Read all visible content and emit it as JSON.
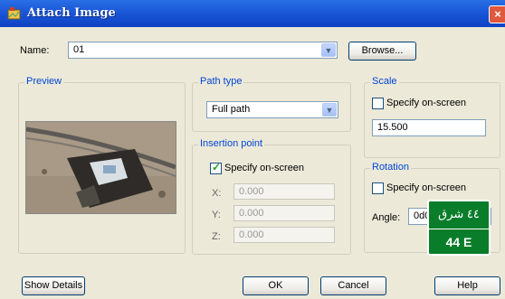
{
  "window": {
    "title": "Attach Image",
    "close_glyph": "×"
  },
  "name": {
    "label": "Name:",
    "value": "01",
    "browse_label": "Browse..."
  },
  "preview": {
    "title": "Preview"
  },
  "path_type": {
    "title": "Path type",
    "value": "Full path"
  },
  "insertion": {
    "title": "Insertion point",
    "specify_label": "Specify on-screen",
    "specify_checked": true,
    "x_label": "X:",
    "x_value": "0.000",
    "y_label": "Y:",
    "y_value": "0.000",
    "z_label": "Z:",
    "z_value": "0.000"
  },
  "scale": {
    "title": "Scale",
    "specify_label": "Specify on-screen",
    "specify_checked": false,
    "value": "15.500"
  },
  "rotation": {
    "title": "Rotation",
    "specify_label": "Specify on-screen",
    "specify_checked": false,
    "angle_label": "Angle:",
    "angle_value": "0d0"
  },
  "buttons": {
    "show_details": "Show Details",
    "ok": "OK",
    "cancel": "Cancel",
    "help": "Help"
  },
  "overlay": {
    "top": "٤٤ شرق",
    "bottom": "44 E"
  },
  "icons": {
    "app": "image-attach-icon",
    "dropdown": "chevron-down-icon"
  },
  "colors": {
    "title_bar": "#1a56d8",
    "dialog": "#ece9d8",
    "group_title": "#0046d5",
    "sign": "#0a7d2a"
  }
}
